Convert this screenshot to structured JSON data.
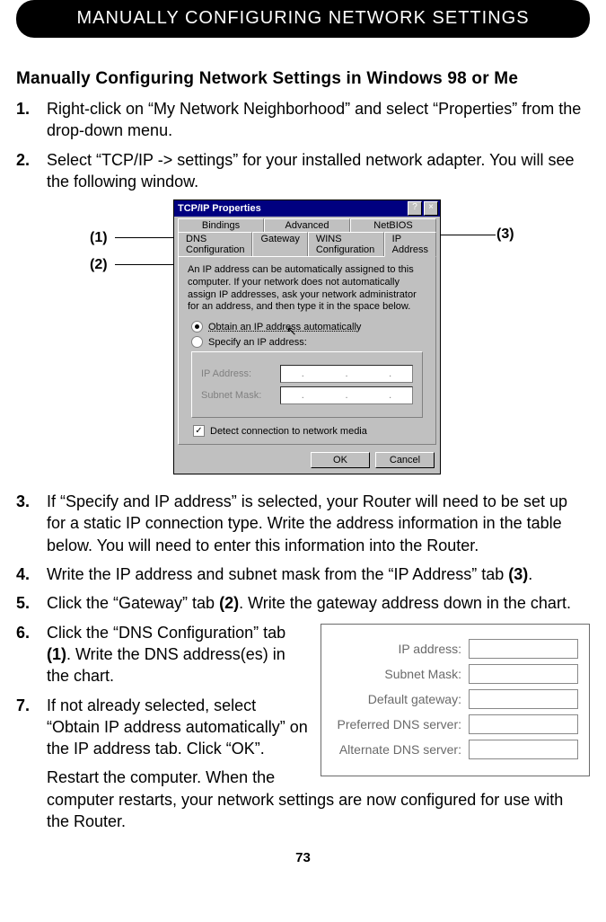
{
  "header": {
    "title": "MANUALLY CONFIGURING NETWORK SETTINGS"
  },
  "section_title": "Manually Configuring Network Settings in Windows 98 or Me",
  "steps": {
    "s1": "Right-click on “My Network Neighborhood” and select “Properties” from the drop-down menu.",
    "s2": "Select “TCP/IP -> settings” for your installed network adapter. You will see the following window.",
    "s3": "If “Specify and IP address” is selected, your Router will need to be set up for a static IP connection type. Write the address information in the table below. You will need to enter this information into the Router.",
    "s4_a": "Write the IP address and subnet mask from the “IP Address” tab ",
    "s4_b": "(3)",
    "s4_c": ".",
    "s5_a": "Click the “Gateway” tab ",
    "s5_b": "(2)",
    "s5_c": ". Write the gateway address down in the chart.",
    "s6_a": "Click the “DNS Configuration” tab ",
    "s6_b": "(1)",
    "s6_c": ". Write the DNS address(es) in the chart.",
    "s7": "If not already selected, select “Obtain IP address automatically” on the IP address tab. Click “OK”.",
    "s7_extra": "Restart the computer. When the computer restarts, your network settings are now configured for use with the Router."
  },
  "callouts": {
    "c1": "(1)",
    "c2": "(2)",
    "c3": "(3)"
  },
  "dialog": {
    "title": "TCP/IP Properties",
    "help": "?",
    "close": "×",
    "tabs_row1": {
      "bindings": "Bindings",
      "advanced": "Advanced",
      "netbios": "NetBIOS"
    },
    "tabs_row2": {
      "dns": "DNS Configuration",
      "gateway": "Gateway",
      "wins": "WINS Configuration",
      "ip": "IP Address"
    },
    "desc": "An IP address can be automatically assigned to this computer. If your network does not automatically assign IP addresses, ask your network administrator for an address, and then type it in the space below.",
    "radio1": "Obtain an IP address automatically",
    "radio2": "Specify an IP address:",
    "ip_label": "IP Address:",
    "subnet_label": "Subnet Mask:",
    "detect": "Detect connection to network media",
    "ok": "OK",
    "cancel": "Cancel",
    "dot": "."
  },
  "form": {
    "ip": "IP address:",
    "subnet": "Subnet Mask:",
    "gateway": "Default gateway:",
    "pdns": "Preferred DNS server:",
    "adns": "Alternate DNS server:"
  },
  "page_number": "73"
}
